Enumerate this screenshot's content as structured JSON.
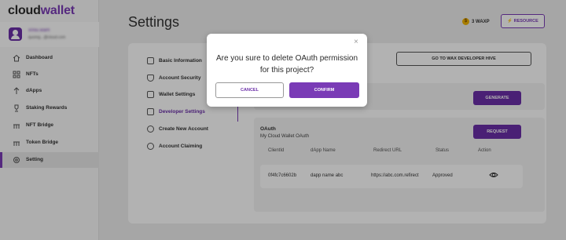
{
  "app": {
    "logo_prefix": "cloud",
    "logo_suffix": "wallet"
  },
  "profile": {
    "name": "s0ou.wam",
    "email": "quomg...@cloud.com"
  },
  "sidebar": {
    "items": [
      {
        "label": "Dashboard",
        "icon": "home-icon"
      },
      {
        "label": "NFTs",
        "icon": "grid-icon"
      },
      {
        "label": "dApps",
        "icon": "dapps-icon"
      },
      {
        "label": "Staking Rewards",
        "icon": "trophy-icon"
      },
      {
        "label": "NFT Bridge",
        "icon": "bridge-icon"
      },
      {
        "label": "Token Bridge",
        "icon": "bridge-icon"
      },
      {
        "label": "Setting",
        "icon": "gear-icon",
        "active": true
      }
    ]
  },
  "header": {
    "title": "Settings",
    "balance": "3 WAXP",
    "resource_label": "RESOURCE"
  },
  "settings_menu": {
    "items": [
      {
        "label": "Basic Information",
        "icon": "id-card-icon"
      },
      {
        "label": "Account Security",
        "icon": "shield-icon"
      },
      {
        "label": "Wallet Settings",
        "icon": "wallet-icon"
      },
      {
        "label": "Developer Settings",
        "icon": "terminal-icon",
        "active": true
      },
      {
        "label": "Create New Account",
        "icon": "user-plus-icon"
      },
      {
        "label": "Account Claiming",
        "icon": "user-check-icon"
      }
    ]
  },
  "developer": {
    "hive_button": "GO TO WAX DEVELOPER HIVE",
    "generate_button": "GENERATE",
    "oauth_title": "OAuth",
    "oauth_subtitle": "My Cloud Wallet OAuth",
    "request_button": "REQUEST",
    "columns": [
      "ClientId",
      "dApp Name",
      "Redirect URL",
      "Status",
      "Action"
    ],
    "rows": [
      {
        "client_id": "0f4fc7c6602b",
        "dapp_name": "dapp name abc",
        "redirect_url": "https://abc.com.refirect",
        "status": "Approved"
      }
    ]
  },
  "modal": {
    "message_line1": "Are you sure to delete OAuth permission",
    "message_line2": "for this project?",
    "cancel_label": "CANCEL",
    "confirm_label": "CONFIRM",
    "close_symbol": "×"
  },
  "colors": {
    "accent": "#7a3bb6",
    "accent_dark": "#6b2fa8",
    "coin": "#f0b400"
  }
}
